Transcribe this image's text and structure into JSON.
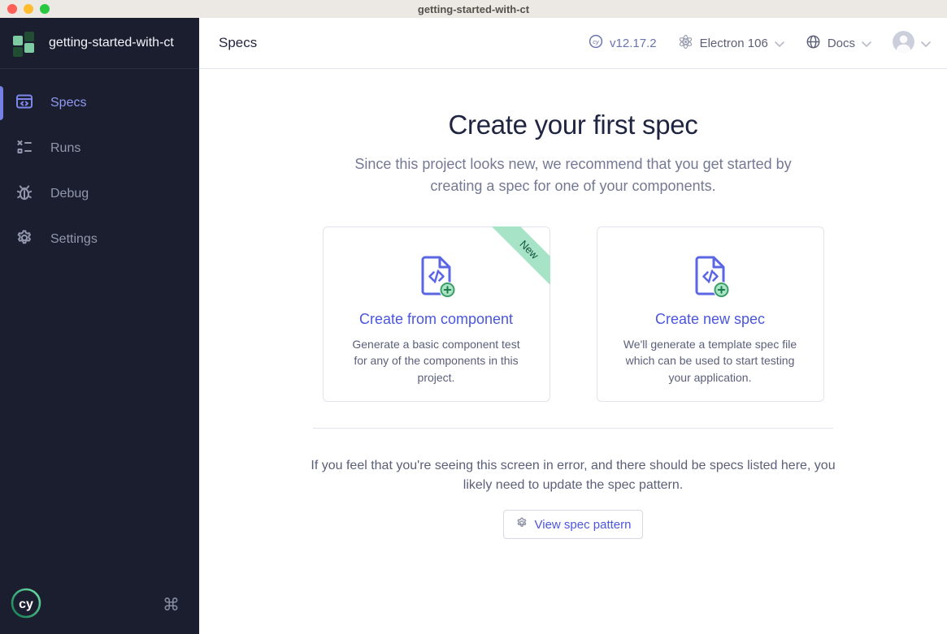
{
  "window": {
    "title": "getting-started-with-ct"
  },
  "sidebar": {
    "project_name": "getting-started-with-ct",
    "items": [
      {
        "label": "Specs",
        "active": true
      },
      {
        "label": "Runs",
        "active": false
      },
      {
        "label": "Debug",
        "active": false
      },
      {
        "label": "Settings",
        "active": false
      }
    ]
  },
  "header": {
    "title": "Specs",
    "version": "v12.17.2",
    "browser": "Electron 106",
    "docs_label": "Docs"
  },
  "main": {
    "heading": "Create your first spec",
    "subheading": "Since this project looks new, we recommend that you get started by creating a spec for one of your components.",
    "cards": [
      {
        "badge": "New",
        "title": "Create from component",
        "description": "Generate a basic component test for any of the components in this project."
      },
      {
        "title": "Create new spec",
        "description": "We'll generate a template spec file which can be used to start testing your application."
      }
    ],
    "footer_note": "If you feel that you're seeing this screen in error, and there should be specs listed here, you likely need to update the spec pattern.",
    "footer_button": "View spec pattern"
  },
  "icons": {
    "command": "⌘",
    "cy": "cy"
  },
  "colors": {
    "sidebar_bg": "#1b1e2e",
    "accent_indigo": "#4a56de",
    "active_nav": "#7580e6",
    "ribbon_green": "#a6e3c7",
    "border": "#e1e3ed",
    "text_dark": "#1f2540",
    "text_gray": "#747994"
  }
}
